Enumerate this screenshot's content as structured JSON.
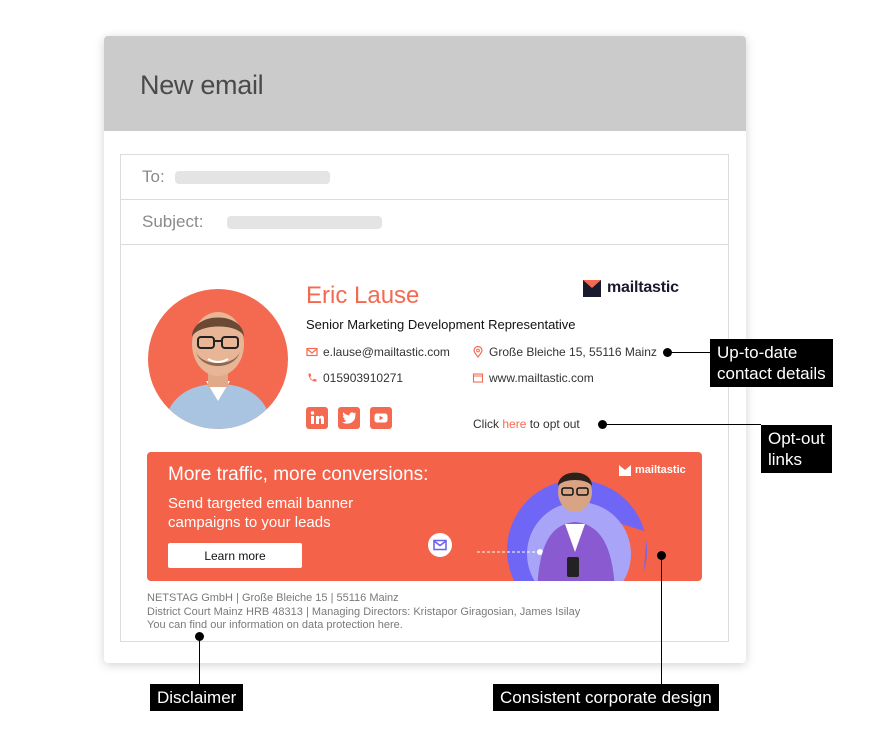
{
  "window": {
    "title": "New email",
    "to_label": "To:",
    "subject_label": "Subject:"
  },
  "signature": {
    "name": "Eric Lause",
    "role": "Senior Marketing Development Representative",
    "logo_text": "mailtastic",
    "email": "e.lause@mailtastic.com",
    "phone": "015903910271",
    "address": "Große Bleiche 15, 55116 Mainz",
    "website": "www.mailtastic.com",
    "social": [
      "linkedin",
      "twitter",
      "youtube"
    ],
    "optout_prefix": "Click ",
    "optout_link": "here",
    "optout_suffix": " to opt out",
    "accent_color": "#f46a50"
  },
  "banner": {
    "title": "More traffic, more conversions:",
    "subtitle": "Send targeted email banner campaigns to your leads",
    "button_label": "Learn more",
    "logo_text": "mailtastic",
    "background_color": "#f46249"
  },
  "disclaimer": {
    "line1": "NETSTAG GmbH | Große Bleiche 15 | 55116 Mainz",
    "line2": "District Court Mainz HRB 48313 | Managing Directors: Kristapor Giragosian, James Isilay",
    "line3": "You can find our information on data protection here."
  },
  "callouts": {
    "contact": "Up-to-date contact details",
    "contact_line1": "Up-to-date",
    "contact_line2": "contact details",
    "optout_line1": "Opt-out",
    "optout_line2": "links",
    "disclaimer": "Disclaimer",
    "design": "Consistent corporate design"
  }
}
